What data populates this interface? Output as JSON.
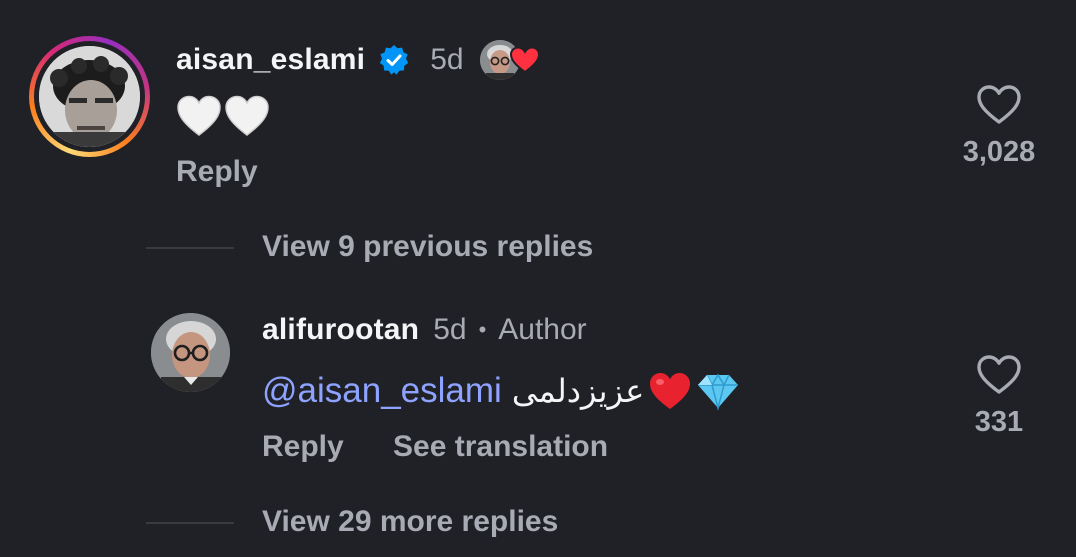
{
  "comments": [
    {
      "username": "aisan_eslami",
      "verified": true,
      "time": "5d",
      "liked_by_author": true,
      "text_icons": [
        "white-heart",
        "white-heart"
      ],
      "reply_label": "Reply",
      "like_count": "3,028"
    },
    {
      "username": "alifurootan",
      "time": "5d",
      "separator": "•",
      "author_tag": "Author",
      "mention": "@aisan_eslami",
      "persian_text": "عزیزدلمی",
      "text_icons": [
        "red-heart",
        "gem"
      ],
      "reply_label": "Reply",
      "translate_label": "See translation",
      "like_count": "331"
    }
  ],
  "threads": {
    "previous": "View 9 previous replies",
    "more": "View 29 more replies"
  },
  "colors": {
    "background": "#202126",
    "primary_text": "#f3f5f7",
    "secondary_text": "#a8abb3",
    "mention": "#8ea3ff",
    "verified": "#0095f6",
    "heart_red": "#ff3040"
  }
}
